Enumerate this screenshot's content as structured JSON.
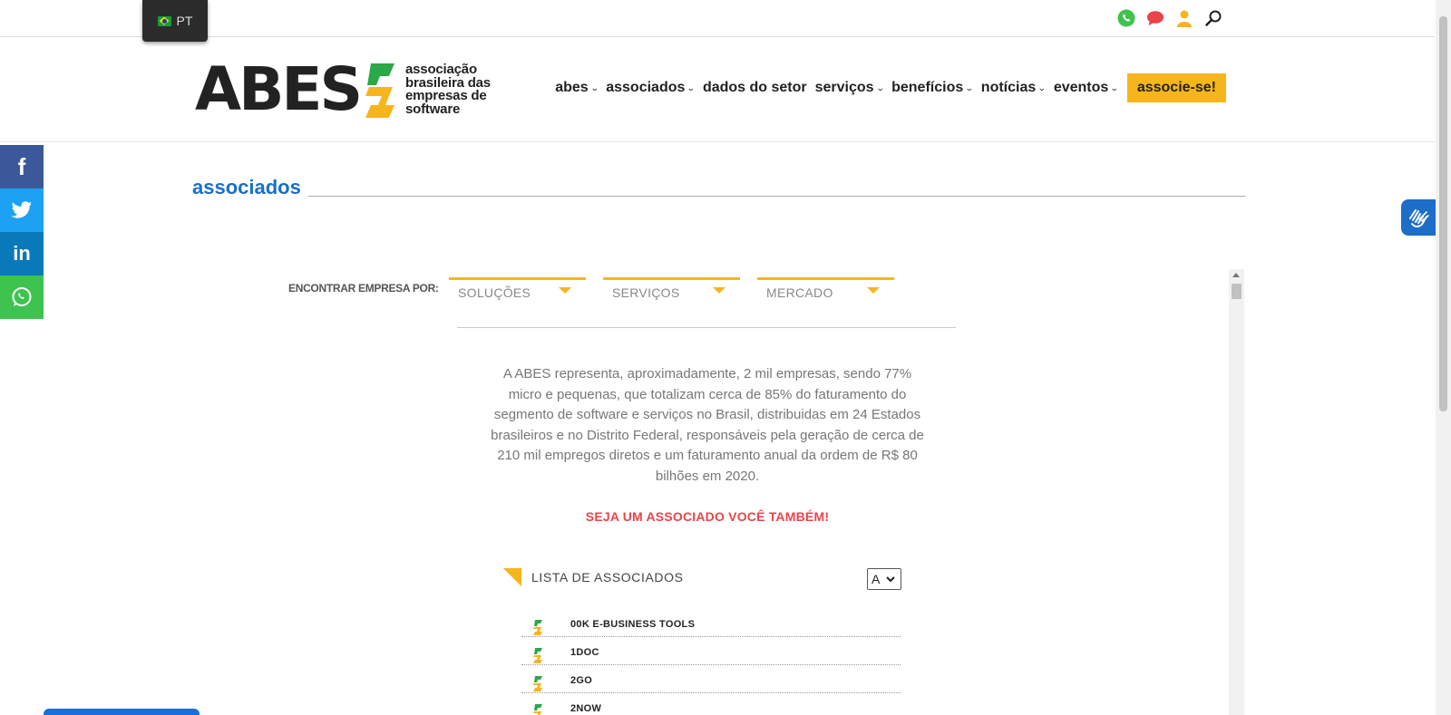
{
  "topbar": {
    "language": "PT",
    "icons": [
      "whatsapp-icon",
      "chat-icon",
      "user-icon",
      "search-icon"
    ]
  },
  "header": {
    "logo_text": "ABES",
    "logo_tagline": [
      "associação",
      "brasileira das",
      "empresas de",
      "software"
    ],
    "nav": [
      {
        "label": "abes",
        "dropdown": true
      },
      {
        "label": "associados",
        "dropdown": true
      },
      {
        "label": "dados do setor",
        "dropdown": false
      },
      {
        "label": "serviços",
        "dropdown": true
      },
      {
        "label": "benefícios",
        "dropdown": true
      },
      {
        "label": "notícias",
        "dropdown": true
      },
      {
        "label": "eventos",
        "dropdown": true
      }
    ],
    "cta": "associe-se!"
  },
  "social": [
    "f",
    "twitter",
    "in",
    "whatsapp"
  ],
  "page": {
    "title": "associados"
  },
  "finder": {
    "label": "ENCONTRAR EMPRESA POR:",
    "filters": [
      "SOLUÇÕES",
      "SERVIÇOS",
      "MERCADO"
    ]
  },
  "description": "A ABES representa, aproximadamente, 2 mil empresas, sendo 77% micro e pequenas, que totalizam cerca de 85% do faturamento do segmento de software e serviços no Brasil, distribuidas em 24 Estados brasileiros e no Distrito Federal, responsáveis pela geração de cerca de 210 mil empregos diretos e um faturamento anual da ordem de R$ 80 bilhões em 2020.",
  "cta_join": "SEJA UM ASSOCIADO VOCÊ TAMBÉM!",
  "list": {
    "title": "LISTA DE ASSOCIADOS",
    "selected_letter": "A",
    "items": [
      "00K E-BUSINESS TOOLS",
      "1DOC",
      "2GO",
      "2NOW"
    ]
  },
  "colors": {
    "accent_yellow": "#f7b51d",
    "brand_blue": "#1a6fc6",
    "cta_red": "#e8444a",
    "logo_green": "#2aa84a"
  }
}
